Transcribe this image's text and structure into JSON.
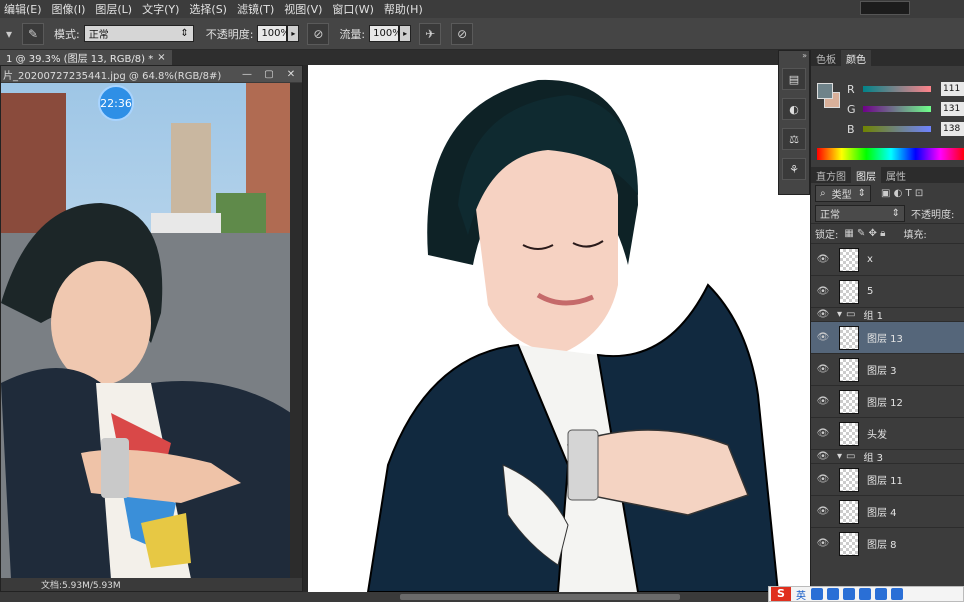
{
  "menu": [
    "编辑(E)",
    "图像(I)",
    "图层(L)",
    "文字(Y)",
    "选择(S)",
    "滤镜(T)",
    "视图(V)",
    "窗口(W)",
    "帮助(H)"
  ],
  "options": {
    "mode_label": "模式:",
    "mode_value": "正常",
    "opacity_label": "不透明度:",
    "opacity_value": "100%",
    "flow_label": "流量:",
    "flow_value": "100%"
  },
  "doc_tab": "1 @ 39.3% (图层 13, RGB/8) *",
  "ref_window": {
    "title": "片_20200727235441.jpg @ 64.8%(RGB/8#)",
    "clock": "22:36",
    "status": "文档:5.93M/5.93M"
  },
  "color_panel": {
    "tabs": [
      "色板",
      "颜色"
    ],
    "fg_color": "#6f838a",
    "bg_color": "#d9b09a",
    "sliders": [
      {
        "label": "R",
        "value": "111"
      },
      {
        "label": "G",
        "value": "131"
      },
      {
        "label": "B",
        "value": "138"
      }
    ]
  },
  "layers_panel": {
    "tabs": [
      "直方图",
      "图层",
      "属性"
    ],
    "kind_label": "类型",
    "blend_mode": "正常",
    "opacity_label": "不透明度:",
    "lock_label": "锁定:",
    "fill_label": "填充:",
    "rows": [
      {
        "type": "layer",
        "name": "x"
      },
      {
        "type": "layer",
        "name": "5"
      },
      {
        "type": "group",
        "name": "组 1"
      },
      {
        "type": "layer",
        "name": "图层 13",
        "selected": true
      },
      {
        "type": "layer",
        "name": "图层 3"
      },
      {
        "type": "layer",
        "name": "图层 12"
      },
      {
        "type": "layer",
        "name": "头发"
      },
      {
        "type": "group",
        "name": "组 3"
      },
      {
        "type": "layer",
        "name": "图层 11"
      },
      {
        "type": "layer",
        "name": "图层 4"
      },
      {
        "type": "layer",
        "name": "图层 8"
      }
    ]
  },
  "ime": {
    "logo": "S",
    "lang": "英"
  }
}
